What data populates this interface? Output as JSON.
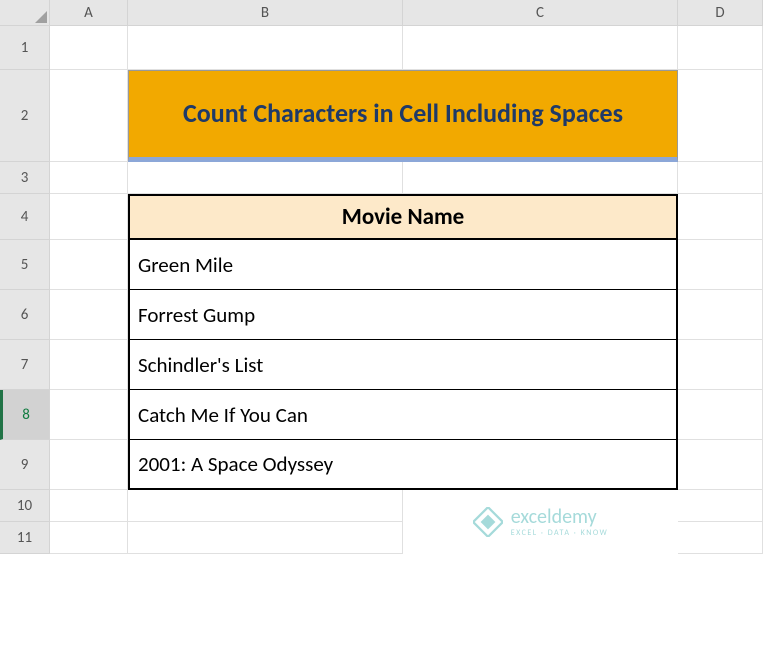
{
  "columns": [
    "A",
    "B",
    "C",
    "D"
  ],
  "rows": [
    "1",
    "2",
    "3",
    "4",
    "5",
    "6",
    "7",
    "8",
    "9",
    "10",
    "11"
  ],
  "selected_row": "8",
  "title": "Count Characters in Cell Including Spaces",
  "table": {
    "header": "Movie Name",
    "data": [
      "Green Mile",
      "Forrest Gump",
      "Schindler's List",
      "Catch Me If You Can",
      "2001: A Space Odyssey"
    ]
  },
  "watermark": {
    "brand": "exceldemy",
    "tagline": "EXCEL · DATA · KNOW"
  }
}
